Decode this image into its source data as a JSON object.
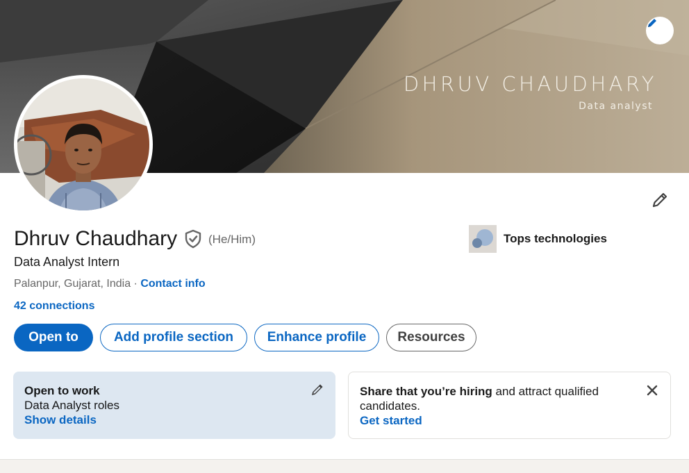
{
  "banner": {
    "name_text": "DHRUV CHAUDHARY",
    "role_text": "Data analyst",
    "edit_icon": "pencil-icon"
  },
  "profile": {
    "name": "Dhruv Chaudhary",
    "verified_icon": "shield-check-icon",
    "pronouns": "(He/Him)",
    "headline": "Data Analyst Intern",
    "location": "Palanpur, Gujarat, India",
    "location_separator": " · ",
    "contact_info_label": "Contact info",
    "connections_label": "42 connections"
  },
  "company": {
    "name": "Tops technologies"
  },
  "actions": {
    "open_to": "Open to",
    "add_profile_section": "Add profile section",
    "enhance_profile": "Enhance profile",
    "resources": "Resources"
  },
  "open_to_work": {
    "title": "Open to work",
    "roles": "Data Analyst roles",
    "link": "Show details"
  },
  "hiring": {
    "text_strong": "Share that you’re hiring",
    "text_rest": " and attract qualified candidates.",
    "link": "Get started"
  },
  "colors": {
    "brand_blue": "#0a66c2",
    "open_to_work_bg": "#dde7f1",
    "banner_gold": "#b09d82",
    "banner_dark": "#2f2f2f"
  }
}
